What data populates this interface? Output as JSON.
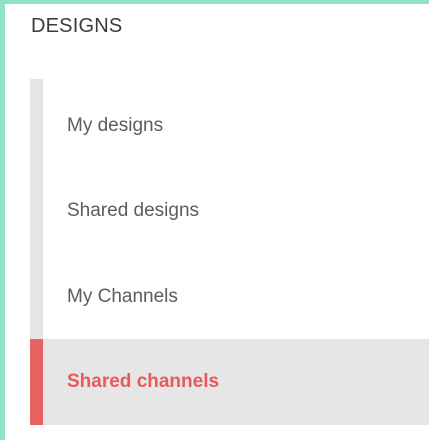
{
  "colors": {
    "frame": "#8fe2c8",
    "accent": "#e86262",
    "rail": "#e5e5e5",
    "active_bg": "#e6e6e6",
    "text": "#5c5c5c"
  },
  "section": {
    "title": "DESIGNS"
  },
  "nav": {
    "items": [
      {
        "label": "My designs",
        "active": false
      },
      {
        "label": "Shared designs",
        "active": false
      },
      {
        "label": "My Channels",
        "active": false
      },
      {
        "label": "Shared channels",
        "active": true
      }
    ]
  }
}
